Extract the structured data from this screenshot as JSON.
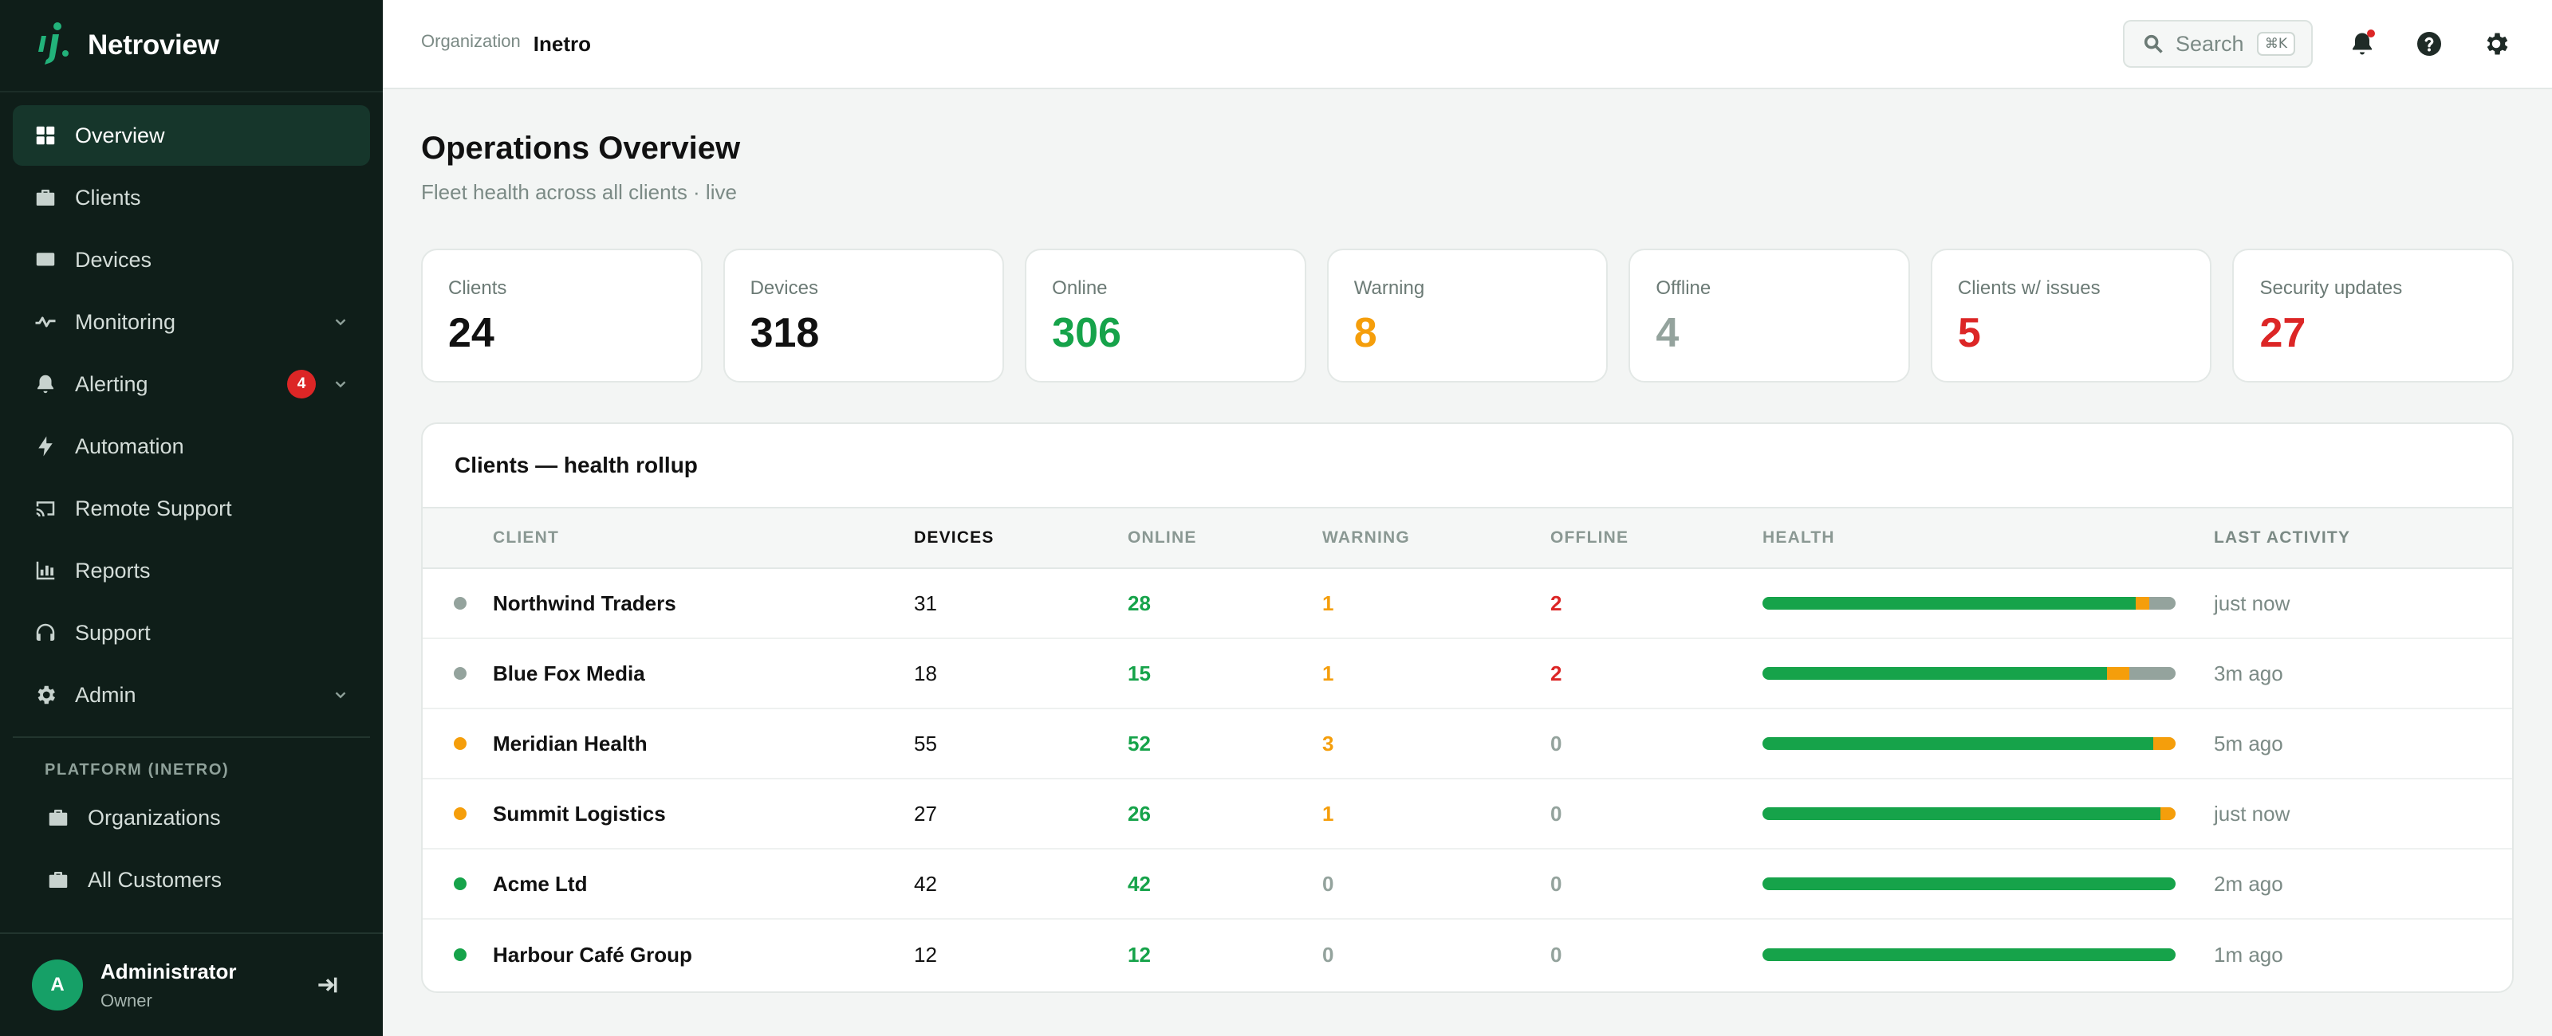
{
  "brand": {
    "name": "Netroview"
  },
  "sidebar": {
    "items": [
      {
        "label": "Overview",
        "icon": "grid-icon",
        "active": true
      },
      {
        "label": "Clients",
        "icon": "briefcase-icon"
      },
      {
        "label": "Devices",
        "icon": "monitor-icon"
      },
      {
        "label": "Monitoring",
        "icon": "pulse-icon",
        "chevron": true
      },
      {
        "label": "Alerting",
        "icon": "bell-icon",
        "badge": "4",
        "chevron": true
      },
      {
        "label": "Automation",
        "icon": "bolt-icon"
      },
      {
        "label": "Remote Support",
        "icon": "cast-icon"
      },
      {
        "label": "Reports",
        "icon": "bar-chart-icon"
      },
      {
        "label": "Support",
        "icon": "headset-icon"
      },
      {
        "label": "Admin",
        "icon": "gear-icon",
        "chevron": true
      }
    ],
    "platform_section": "PLATFORM (INETRO)",
    "platform_items": [
      {
        "label": "Organizations",
        "icon": "briefcase-icon"
      },
      {
        "label": "All Customers",
        "icon": "briefcase-icon"
      }
    ]
  },
  "user": {
    "initial": "A",
    "name": "Administrator",
    "role": "Owner"
  },
  "topbar": {
    "org_label": "Organization",
    "org_value": "Inetro",
    "search_placeholder": "Search",
    "search_shortcut": "⌘K"
  },
  "page": {
    "title": "Operations Overview",
    "subtitle": "Fleet health across all clients · live"
  },
  "stats": [
    {
      "label": "Clients",
      "value": "24",
      "color": "#111111"
    },
    {
      "label": "Devices",
      "value": "318",
      "color": "#111111"
    },
    {
      "label": "Online",
      "value": "306",
      "color": "#16a34a"
    },
    {
      "label": "Warning",
      "value": "8",
      "color": "#f59e0b"
    },
    {
      "label": "Offline",
      "value": "4",
      "color": "#94a39d"
    },
    {
      "label": "Clients w/ issues",
      "value": "5",
      "color": "#dc2626"
    },
    {
      "label": "Security updates",
      "value": "27",
      "color": "#dc2626"
    }
  ],
  "table": {
    "title": "Clients — health rollup",
    "headers": {
      "client": "CLIENT",
      "devices": "DEVICES",
      "online": "ONLINE",
      "warning": "WARNING",
      "offline": "OFFLINE",
      "health": "HEALTH",
      "activity": "LAST ACTIVITY"
    },
    "rows": [
      {
        "status": "offline",
        "client": "Northwind Traders",
        "devices": "31",
        "online": "28",
        "warning": "1",
        "offline": "2",
        "activity": "just now"
      },
      {
        "status": "offline",
        "client": "Blue Fox Media",
        "devices": "18",
        "online": "15",
        "warning": "1",
        "offline": "2",
        "activity": "3m ago"
      },
      {
        "status": "warning",
        "client": "Meridian Health",
        "devices": "55",
        "online": "52",
        "warning": "3",
        "offline": "0",
        "activity": "5m ago"
      },
      {
        "status": "warning",
        "client": "Summit Logistics",
        "devices": "27",
        "online": "26",
        "warning": "1",
        "offline": "0",
        "activity": "just now"
      },
      {
        "status": "online",
        "client": "Acme Ltd",
        "devices": "42",
        "online": "42",
        "warning": "0",
        "offline": "0",
        "activity": "2m ago"
      },
      {
        "status": "online",
        "client": "Harbour Café Group",
        "devices": "12",
        "online": "12",
        "warning": "0",
        "offline": "0",
        "activity": "1m ago"
      }
    ]
  },
  "colors": {
    "online": "#16a34a",
    "warning": "#f59e0b",
    "offline_critical": "#dc2626",
    "muted": "#94a39d",
    "status_offline_dot": "#94a39d",
    "status_warning_dot": "#f59e0b",
    "status_online_dot": "#16a34a",
    "health_offline": "#94a39d"
  }
}
